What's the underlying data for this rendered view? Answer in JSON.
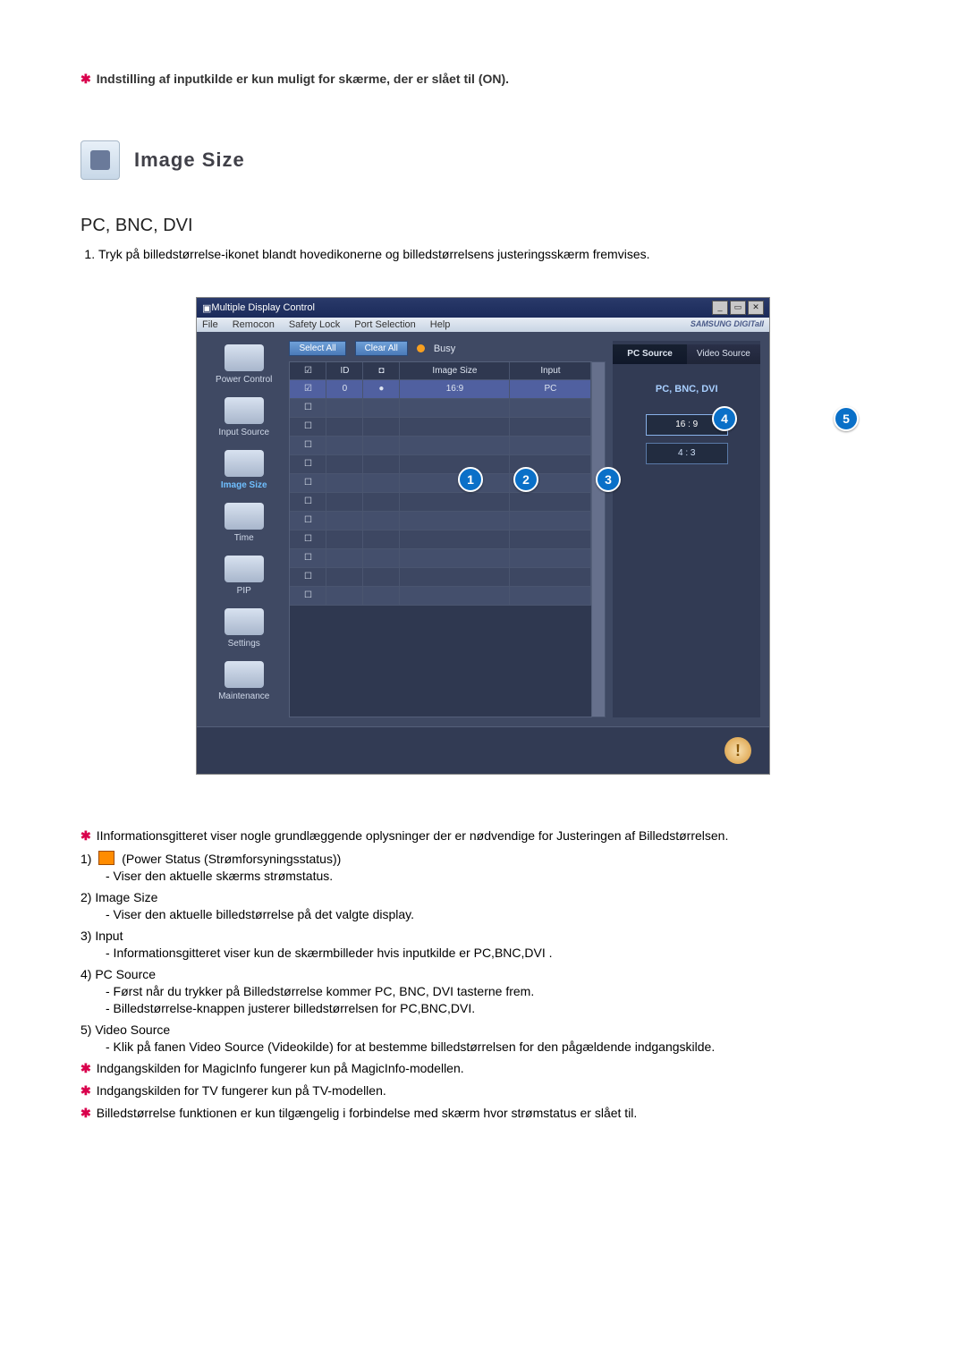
{
  "top_note": "Indstilling af inputkilde er kun muligt for skærme, der er slået til (ON).",
  "section": {
    "title": "Image Size",
    "sub_heading": "PC, BNC, DVI",
    "intro_item": "Tryk på billedstørrelse-ikonet blandt hovedikonerne og billedstørrelsens justeringsskærm fremvises."
  },
  "screenshot": {
    "window_title": "Multiple Display Control",
    "menu": {
      "file": "File",
      "remocon": "Remocon",
      "safety": "Safety Lock",
      "port": "Port Selection",
      "help": "Help"
    },
    "brand": "SAMSUNG DIGITall",
    "sidebar": {
      "power": "Power Control",
      "input": "Input Source",
      "image_size": "Image Size",
      "time": "Time",
      "pip": "PIP",
      "settings": "Settings",
      "maintenance": "Maintenance"
    },
    "buttons": {
      "select_all": "Select All",
      "clear_all": "Clear All",
      "busy": "Busy"
    },
    "grid_headers": {
      "id": "ID",
      "image_size": "Image Size",
      "input": "Input"
    },
    "grid_row0": {
      "id": "0",
      "image_size": "16:9",
      "input": "PC"
    },
    "tabs": {
      "pc": "PC Source",
      "video": "Video Source"
    },
    "panel_title": "PC, BNC, DVI",
    "ratio_169": "16 : 9",
    "ratio_43": "4 : 3",
    "callouts": {
      "c1": "1",
      "c2": "2",
      "c3": "3",
      "c4": "4",
      "c5": "5"
    },
    "win_btns": {
      "min": "_",
      "restore": "▭",
      "close": "✕"
    }
  },
  "info": {
    "line1": "IInformationsgitteret viser nogle grundlæggende oplysninger der er nødvendige for Justeringen af Billedstørrelsen.",
    "i1": {
      "num": "1)",
      "label": "(Power Status (Strømforsyningsstatus))",
      "sub1": "- Viser den aktuelle skærms strømstatus."
    },
    "i2": {
      "num": "2)",
      "label": "Image Size",
      "sub1": "- Viser den aktuelle billedstørrelse på det valgte display."
    },
    "i3": {
      "num": "3)",
      "label": "Input",
      "sub1": "- Informationsgitteret viser kun de skærmbilleder hvis inputkilde er PC,BNC,DVI ."
    },
    "i4": {
      "num": "4)",
      "label": "PC Source",
      "sub1": "- Først når du trykker på Billedstørrelse kommer PC, BNC, DVI tasterne frem.",
      "sub2": "- Billedstørrelse-knappen justerer billedstørrelsen for PC,BNC,DVI."
    },
    "i5": {
      "num": "5)",
      "label": "Video Source",
      "sub1": "- Klik på fanen Video Source (Videokilde) for at bestemme billedstørrelsen for den pågældende indgangskilde."
    },
    "note_magic": "Indgangskilden for MagicInfo fungerer kun på MagicInfo-modellen.",
    "note_tv": "Indgangskilden for TV fungerer kun på TV-modellen.",
    "note_power": "Billedstørrelse funktionen er kun tilgængelig i forbindelse med skærm hvor strømstatus er slået til."
  }
}
